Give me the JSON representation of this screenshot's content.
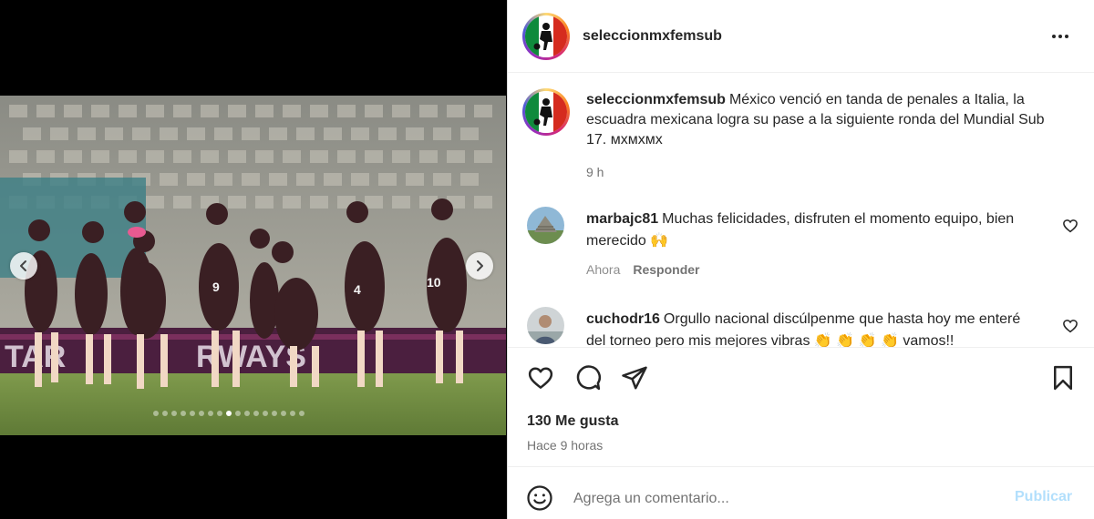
{
  "post": {
    "username": "seleccionmxfemsub",
    "more_icon": "more-horizontal-icon"
  },
  "media": {
    "description_icon": "photo",
    "slide_count": 17,
    "active_slide_index": 8,
    "prev_icon": "chevron-left-icon",
    "next_icon": "chevron-right-icon"
  },
  "caption": {
    "username": "seleccionmxfemsub",
    "text": "México venció en tanda de penales a Italia, la escuadra mexicana logra su pase a la siguiente ronda del Mundial Sub 17. мхмхмх",
    "time": "9 h"
  },
  "comments": [
    {
      "username": "marbajc81",
      "text": "Muchas felicidades, disfruten el momento equipo, bien merecido 🙌",
      "time": "Ahora",
      "reply_label": "Responder"
    },
    {
      "username": "cuchodr16",
      "text": "Orgullo nacional discúlpenme que hasta hoy me enteré del torneo pero mis mejores vibras 👏 👏 👏 👏 vamos!!",
      "time": "",
      "reply_label": ""
    }
  ],
  "actions": {
    "likes": "130 Me gusta",
    "posted_ago": "Hace 9 horas"
  },
  "composer": {
    "placeholder": "Agrega un comentario...",
    "publish_label": "Publicar"
  },
  "colors": {
    "accent_disabled": "#b2dffc",
    "text": "#262626",
    "muted": "#737373"
  }
}
